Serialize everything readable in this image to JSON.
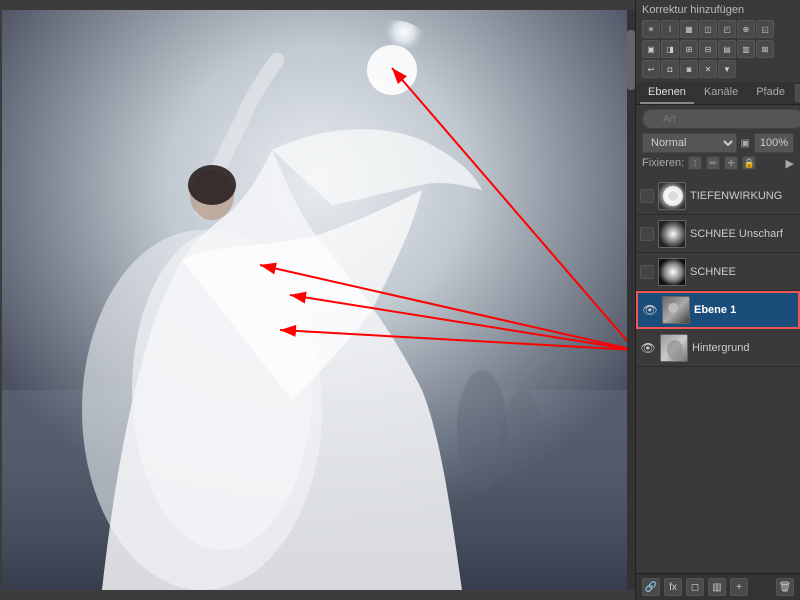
{
  "panel": {
    "title": "Korrektur hinzufügen",
    "tabs": [
      {
        "label": "Ebenen",
        "active": true
      },
      {
        "label": "Kanäle",
        "active": false
      },
      {
        "label": "Pfade",
        "active": false
      }
    ],
    "search_placeholder": "Art",
    "blend_mode": "Normal",
    "opacity_label": "",
    "fixieren_label": "Fixieren:",
    "layers": [
      {
        "id": "tiefenwirkung",
        "name": "TIEFENWIRKUNG",
        "visible": false,
        "active": false,
        "thumb_class": "thumb-tiefe"
      },
      {
        "id": "schnee-unscharf",
        "name": "SCHNEE Unscharf",
        "visible": false,
        "active": false,
        "thumb_class": "thumb-schnee-unscharf"
      },
      {
        "id": "schnee",
        "name": "SCHNEE",
        "visible": false,
        "active": false,
        "thumb_class": "thumb-schnee"
      },
      {
        "id": "ebene1",
        "name": "Ebene 1",
        "visible": true,
        "active": true,
        "thumb_class": "thumb-ebene1"
      },
      {
        "id": "hintergrund",
        "name": "Hintergrund",
        "visible": true,
        "active": false,
        "thumb_class": "thumb-hintergrund"
      }
    ]
  },
  "toolbar": {
    "icons": [
      "☀",
      "♛",
      "▦",
      "◫",
      "◰",
      "⚖",
      "◱",
      "⊕",
      "↩",
      "◨",
      "▣",
      "✕"
    ]
  },
  "arrows": {
    "color": "#ff0000"
  }
}
